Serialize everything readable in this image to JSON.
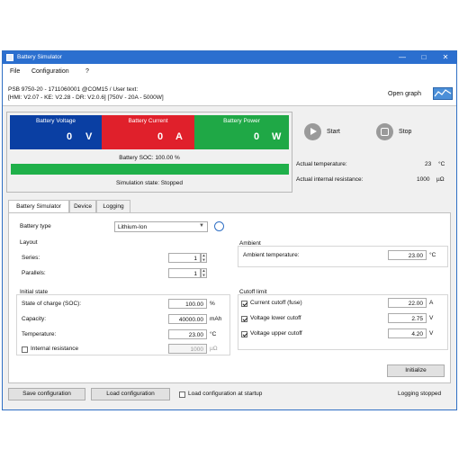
{
  "window": {
    "title": "Battery Simulator"
  },
  "menu": {
    "items": [
      "File",
      "Configuration",
      "?"
    ]
  },
  "device": {
    "line1": "PSB 9750-20 - 1711060001 @COM15 / User text:",
    "line2": "[HMI: V2.07 - KE: V2.28 - DR: V2.0.6] [750V - 20A - 5000W]",
    "open_graph": "Open graph"
  },
  "meters": {
    "voltage": {
      "label": "Battery Voltage",
      "value": "0",
      "unit": "V",
      "color": "#0a3fa3"
    },
    "current": {
      "label": "Battery Current",
      "value": "0",
      "unit": "A",
      "color": "#e0202b"
    },
    "power": {
      "label": "Battery Power",
      "value": "0",
      "unit": "W",
      "color": "#1fa846"
    }
  },
  "soc": {
    "label": "Battery SOC: 100.00 %",
    "fraction": 1.0
  },
  "sim_state": "Simulation state: Stopped",
  "controls": {
    "start": "Start",
    "stop": "Stop"
  },
  "actual": {
    "temp_label": "Actual temperature:",
    "temp_value": "23",
    "temp_unit": "°C",
    "res_label": "Actual internal resistance:",
    "res_value": "1000",
    "res_unit": "µΩ"
  },
  "tabs": [
    "Battery Simulator",
    "Device",
    "Logging"
  ],
  "battery_type": {
    "label": "Battery type",
    "value": "Lithium-Ion"
  },
  "layout": {
    "title": "Layout",
    "series_label": "Series:",
    "series_value": "1",
    "parallels_label": "Parallels:",
    "parallels_value": "1"
  },
  "ambient": {
    "title": "Ambient",
    "label": "Ambient temperature:",
    "value": "23.00",
    "unit": "°C"
  },
  "initial_state": {
    "title": "Initial state",
    "soc_label": "State of charge (SOC):",
    "soc_value": "100.00",
    "soc_unit": "%",
    "cap_label": "Capacity:",
    "cap_value": "40000.00",
    "cap_unit": "mAh",
    "temp_label": "Temperature:",
    "temp_value": "23.00",
    "temp_unit": "°C",
    "ir_label": "Internal resistance",
    "ir_value": "1000",
    "ir_unit": "µΩ",
    "ir_checked": false
  },
  "cutoff": {
    "title": "Cutoff limit",
    "current_label": "Current cutoff (fuse)",
    "current_value": "22.00",
    "current_unit": "A",
    "current_checked": true,
    "vlow_label": "Voltage lower cutoff",
    "vlow_value": "2.75",
    "vlow_unit": "V",
    "vlow_checked": true,
    "vup_label": "Voltage upper cutoff",
    "vup_value": "4.20",
    "vup_unit": "V",
    "vup_checked": true
  },
  "initialize": "Initialize",
  "bottom": {
    "save": "Save configuration",
    "load": "Load configuration",
    "load_startup": "Load configuration at startup",
    "load_startup_checked": false,
    "status": "Logging stopped"
  }
}
